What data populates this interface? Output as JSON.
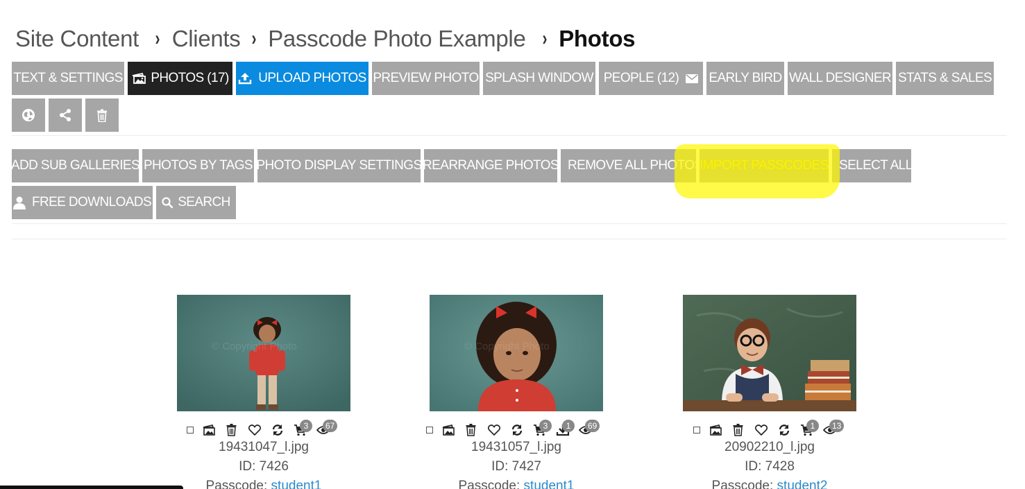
{
  "breadcrumb": {
    "items": [
      "Site Content",
      "Clients",
      "Passcode Photo Example"
    ],
    "current": "Photos",
    "separator": "›"
  },
  "toolbar": {
    "text_settings": "TEXT & SETTINGS",
    "photos": "PHOTOS (17)",
    "upload_photos": "UPLOAD PHOTOS",
    "preview_photo": "PREVIEW PHOTO",
    "splash_window": "SPLASH WINDOW",
    "people": "PEOPLE (12)",
    "early_bird": "EARLY BIRD",
    "wall_designer": "WALL DESIGNER",
    "stats_sales": "STATS & SALES",
    "icon_buttons": [
      "globe-icon",
      "share-icon",
      "trash-icon"
    ]
  },
  "actions": {
    "add_sub_galleries": "ADD SUB GALLERIES",
    "photos_by_tags": "PHOTOS BY TAGS",
    "photo_display_settings": "PHOTO DISPLAY SETTINGS",
    "rearrange_photos": "REARRANGE PHOTOS",
    "remove_all_photos": "REMOVE ALL PHOTOS",
    "import_passcodes": "IMPORT PASSCODES",
    "select_all": "SELECT ALL",
    "free_downloads": "FREE DOWNLOADS",
    "search": "SEARCH"
  },
  "photos": [
    {
      "filename": "19431047_l.jpg",
      "id_label": "ID: 7426",
      "passcode_label": "Passcode:",
      "passcode": "student1",
      "cart_count": "3",
      "download_count": "",
      "view_count": "67"
    },
    {
      "filename": "19431057_l.jpg",
      "id_label": "ID: 7427",
      "passcode_label": "Passcode:",
      "passcode": "student1",
      "cart_count": "3",
      "download_count": "1",
      "view_count": "69"
    },
    {
      "filename": "20902210_l.jpg",
      "id_label": "ID: 7428",
      "passcode_label": "Passcode:",
      "passcode": "student2",
      "cart_count": "1",
      "download_count": "",
      "view_count": "13"
    }
  ],
  "watermark_text": "© Copyright Photo",
  "colors": {
    "button_gray": "#a6a6a6",
    "button_dark": "#222222",
    "button_blue": "#0a8be0",
    "highlight": "#fff600",
    "link": "#2a8ac9"
  }
}
